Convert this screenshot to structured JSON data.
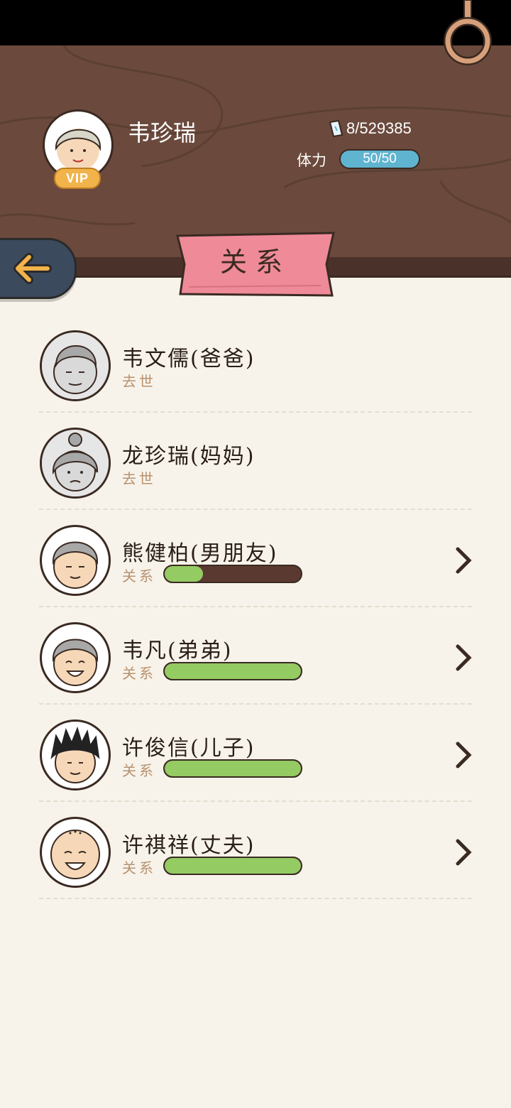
{
  "player": {
    "name": "韦珍瑞",
    "vip_label": "VIP",
    "money": "8/529385",
    "stamina_label": "体力",
    "stamina": "50/50"
  },
  "page": {
    "title": "关系"
  },
  "relations": [
    {
      "name": "韦文儒(爸爸)",
      "status": "去世",
      "relation_label": null,
      "level": null
    },
    {
      "name": "龙珍瑞(妈妈)",
      "status": "去世",
      "relation_label": null,
      "level": null
    },
    {
      "name": "熊健柏(男朋友)",
      "status": null,
      "relation_label": "关系",
      "level": 0.28
    },
    {
      "name": "韦凡(弟弟)",
      "status": null,
      "relation_label": "关系",
      "level": 1.0
    },
    {
      "name": "许俊信(儿子)",
      "status": null,
      "relation_label": "关系",
      "level": 1.0
    },
    {
      "name": "许祺祥(丈夫)",
      "status": null,
      "relation_label": "关系",
      "level": 1.0
    }
  ],
  "colors": {
    "header_wood": "#6b4a3d",
    "background": "#f7f3ea",
    "ribbon": "#ef8a98",
    "stamina": "#5fb4cf",
    "relation_fill": "#94cb63",
    "relation_track": "#5a3a30"
  }
}
